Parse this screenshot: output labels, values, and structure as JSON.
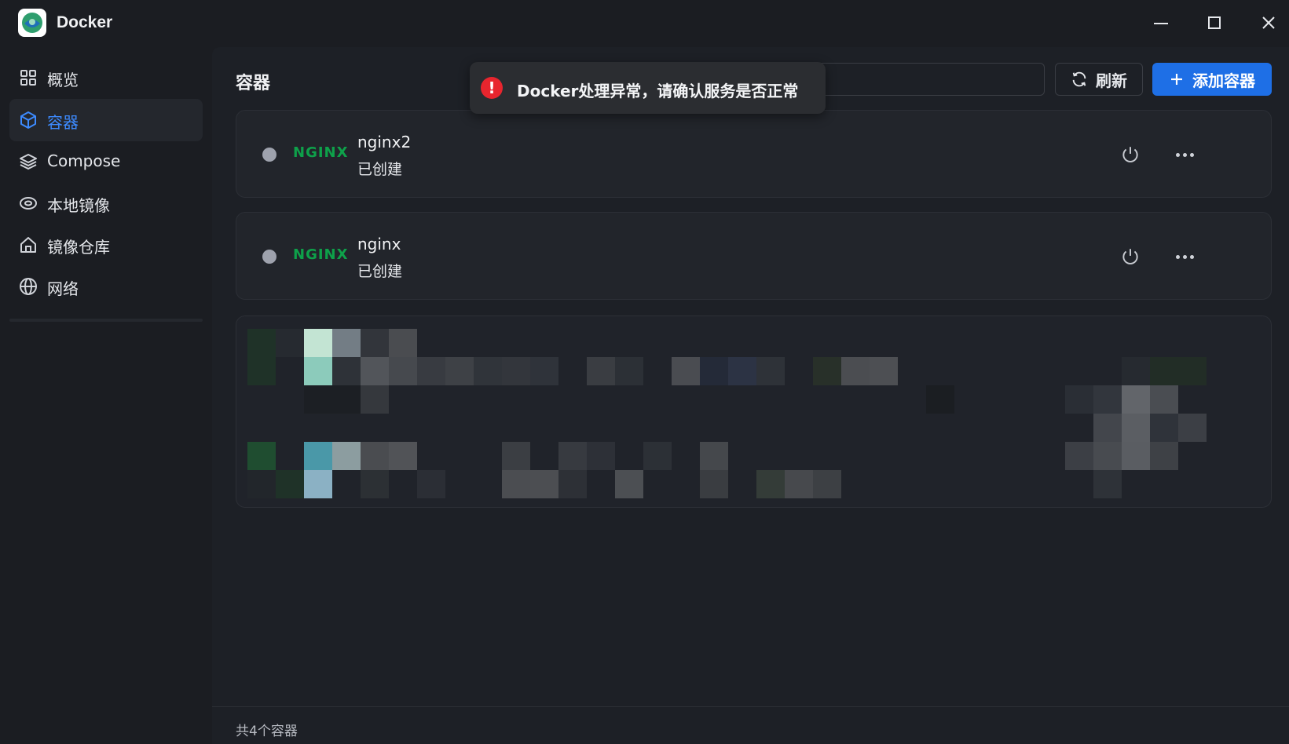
{
  "app": {
    "title": "Docker",
    "logo_icon": "docker-logo-icon"
  },
  "window_controls": [
    "minimize-icon",
    "maximize-icon",
    "close-icon"
  ],
  "sidebar": {
    "items": [
      {
        "label": "概览",
        "icon": "grid-icon",
        "active": false
      },
      {
        "label": "容器",
        "icon": "cube-icon",
        "active": true
      },
      {
        "label": "Compose",
        "icon": "layers-icon",
        "active": false
      },
      {
        "label": "本地镜像",
        "icon": "disk-icon",
        "active": false
      },
      {
        "label": "镜像仓库",
        "icon": "home-icon",
        "active": false
      },
      {
        "label": "网络",
        "icon": "globe-icon",
        "active": false
      }
    ]
  },
  "main": {
    "title": "容器",
    "search": {
      "placeholder": ""
    },
    "refresh_label": "刷新",
    "add_label": "添加容器",
    "containers": [
      {
        "name": "nginx2",
        "status": "已创建",
        "logo": "NGINX"
      },
      {
        "name": "nginx",
        "status": "已创建",
        "logo": "NGINX"
      }
    ],
    "footer": "共4个容器"
  },
  "toast": {
    "message": "Docker处理异常，请确认服务是否正常",
    "icon": "error-icon",
    "color": "#e8252e"
  },
  "colors": {
    "accent": "#1e6fe6",
    "active_text": "#3d8bff",
    "nginx_green": "#0ea14a"
  }
}
